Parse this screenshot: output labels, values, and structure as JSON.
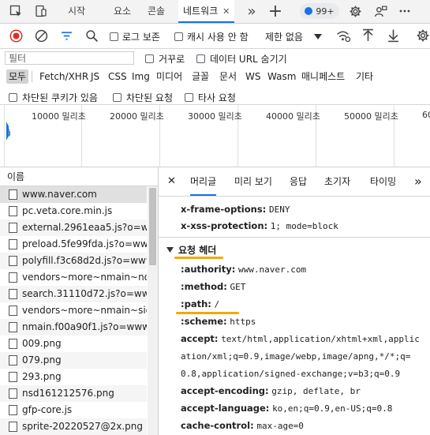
{
  "accent_color": "#1a73e8",
  "annotation_color": "#f5a70a",
  "record_color": "#d93025",
  "tabbar": {
    "tabs": [
      {
        "label": "시작"
      },
      {
        "label": "요소"
      },
      {
        "label": "콘솔"
      },
      {
        "label": "네트워크",
        "active": true
      }
    ],
    "close_glyph": "✕",
    "more_glyph": "»",
    "add_glyph": "+",
    "issues_count": "99+"
  },
  "toolbar": {
    "preserve_log_label": "로그 보존",
    "disable_cache_label": "캐시 사용 안 함",
    "throttling_value": "제한 없음"
  },
  "filter": {
    "placeholder": "필터",
    "invert_label": "거꾸로",
    "hide_data_urls_label": "데이터 URL 숨기기"
  },
  "types": [
    "모두",
    "Fetch/XHR",
    "JS",
    "CSS",
    "Img",
    "미디어",
    "글꼴",
    "문서",
    "WS",
    "Wasm",
    "매니페스트",
    "기타"
  ],
  "blocked": {
    "blocked_cookies_label": "차단된 쿠키가 있음",
    "blocked_requests_label": "차단된 요청",
    "third_party_label": "타사 요청"
  },
  "overview": {
    "tick_labels": [
      "10000 밀리초",
      "20000 밀리초",
      "30000 밀리초",
      "40000 밀리초",
      "50000 밀리초",
      "60"
    ]
  },
  "request_list": {
    "header": "이름",
    "rows": [
      "www.naver.com",
      "pc.veta.core.min.js",
      "external.2961eaa5.js?o=www",
      "preload.5fe99fda.js?o=www",
      "polyfill.f3c68d2d.js?o=www",
      "vendors~more~nmain~notice",
      "search.31110d72.js?o=www",
      "vendors~more~nmain~sideb",
      "nmain.f00a90f1.js?o=www",
      "009.png",
      "079.png",
      "293.png",
      "nsd161212576.png",
      "gfp-core.js",
      "sprite-20220527@2x.png"
    ]
  },
  "details": {
    "close_glyph": "✕",
    "tabs": [
      "머리글",
      "미리 보기",
      "응답",
      "초기자",
      "타이밍"
    ],
    "response_headers": [
      {
        "key": "x-frame-options:",
        "value": "DENY"
      },
      {
        "key": "x-xss-protection:",
        "value": "1; mode=block"
      }
    ],
    "request_section_title": "요청 헤더",
    "request_headers": [
      {
        "key": ":authority:",
        "value": "www.naver.com"
      },
      {
        "key": ":method:",
        "value": "GET"
      },
      {
        "key": ":path:",
        "value": "/"
      },
      {
        "key": ":scheme:",
        "value": "https"
      },
      {
        "key": "accept:",
        "value": "text/html,application/xhtml+xml,applic"
      },
      {
        "key": "",
        "value": "ation/xml;q=0.9,image/webp,image/apng,*/*;q="
      },
      {
        "key": "",
        "value": "0.8,application/signed-exchange;v=b3;q=0.9"
      },
      {
        "key": "accept-encoding:",
        "value": "gzip, deflate, br"
      },
      {
        "key": "accept-language:",
        "value": "ko,en;q=0.9,en-US;q=0.8"
      },
      {
        "key": "cache-control:",
        "value": "max-age=0"
      }
    ]
  }
}
